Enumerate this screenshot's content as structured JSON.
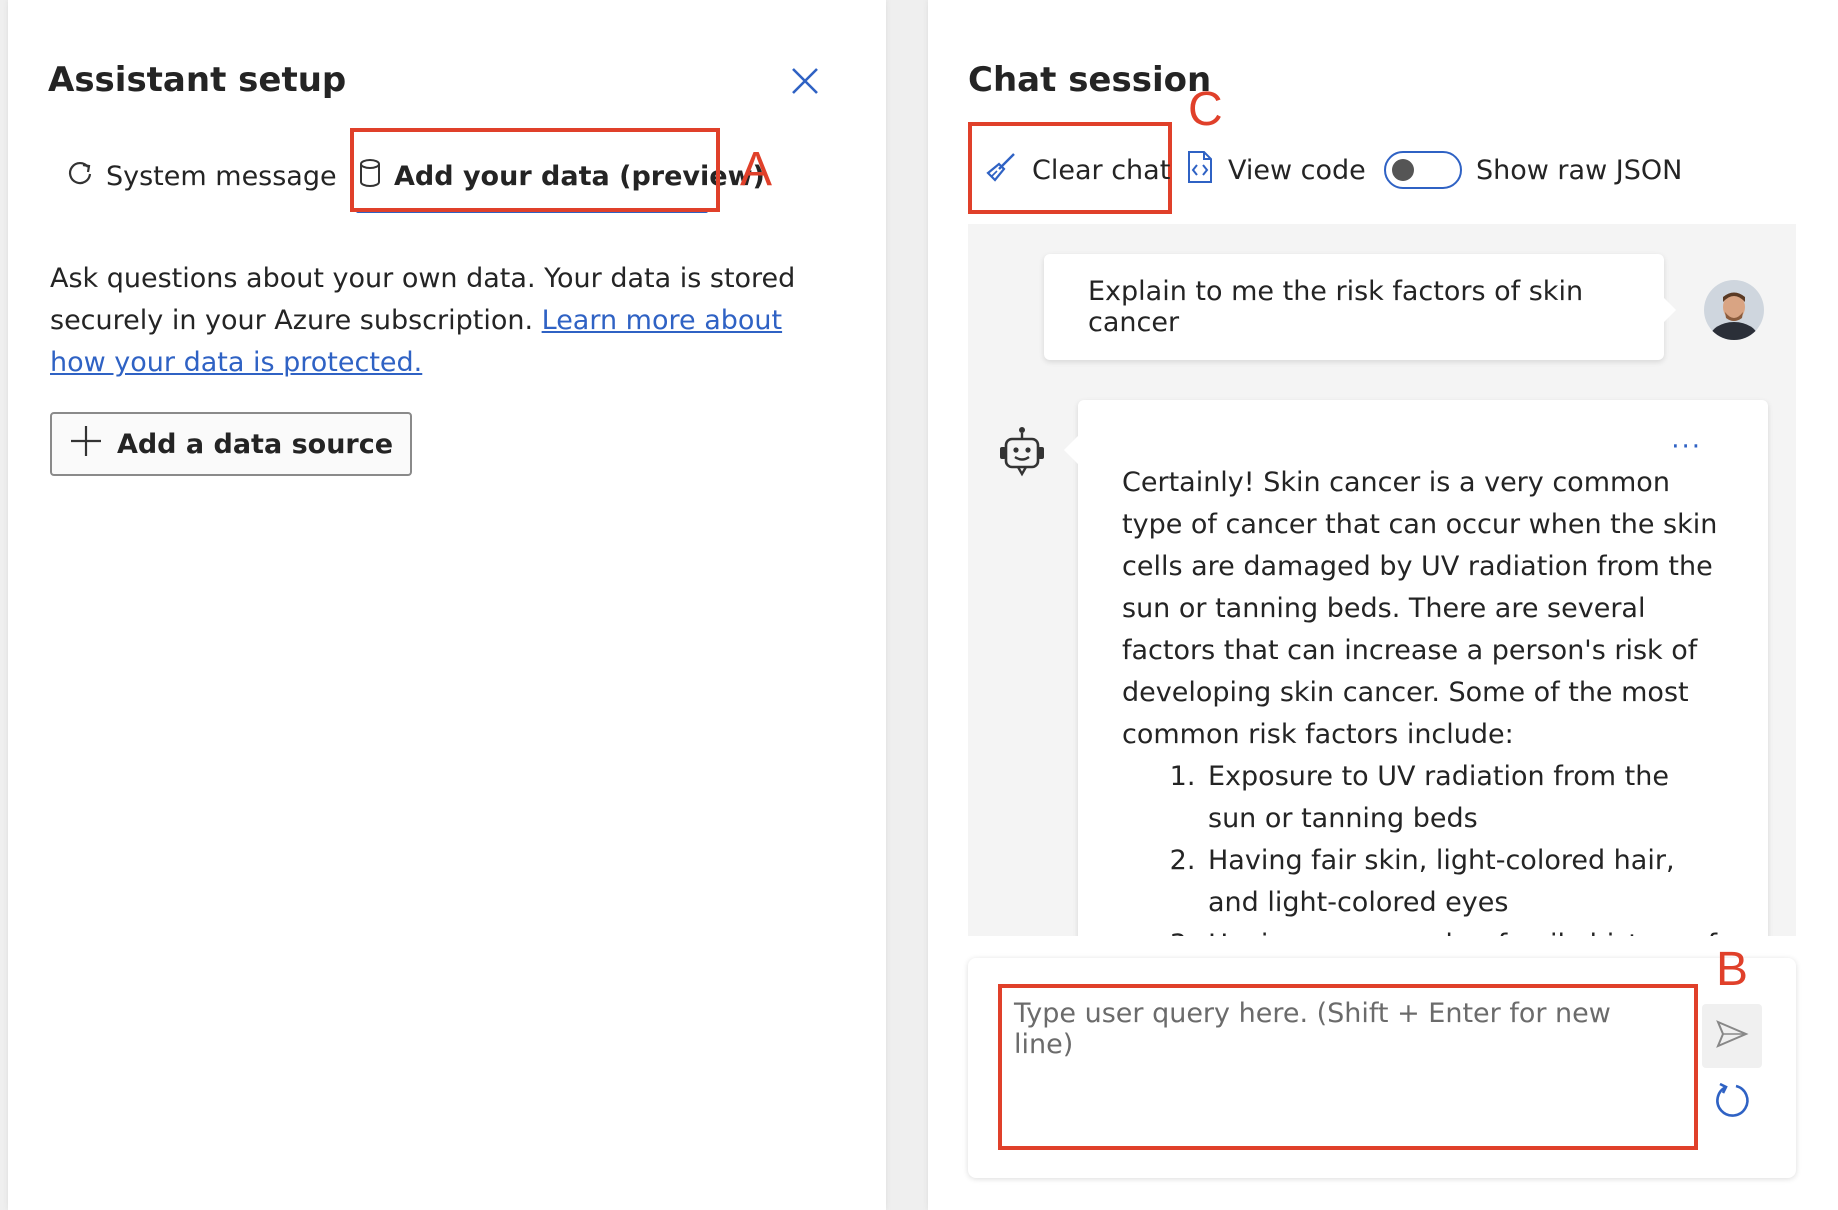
{
  "left_panel": {
    "title": "Assistant setup",
    "tabs": [
      {
        "label": "System message",
        "icon": "refresh-icon"
      },
      {
        "label": "Add your data (preview)",
        "icon": "database-icon",
        "selected": true
      }
    ],
    "description": "Ask questions about your own data. Your data is stored securely in your Azure subscription. ",
    "learn_more_link": "Learn more about how your data is protected.",
    "add_source_label": "Add a data source"
  },
  "right_panel": {
    "title": "Chat session",
    "toolbar": {
      "clear_chat": "Clear chat",
      "view_code": "View code",
      "show_raw_json": "Show raw JSON",
      "raw_json_enabled": false
    },
    "messages": {
      "user": "Explain to me the risk factors of skin cancer",
      "assistant_intro": "Certainly! Skin cancer is a very common type of cancer that can occur when the skin cells are damaged by UV radiation from the sun or tanning beds. There are several factors that can increase a person's risk of developing skin cancer. Some of the most common risk factors include:",
      "assistant_list": [
        "Exposure to UV radiation from the sun or tanning beds",
        "Having fair skin, light-colored hair, and light-colored eyes",
        "Having a personal or family history of skin cancer"
      ],
      "more_options": "···"
    },
    "input_placeholder": "Type user query here. (Shift + Enter for new line)"
  },
  "annotations": {
    "a": "A",
    "b": "B",
    "c": "C"
  },
  "colors": {
    "accent": "#2f62c4",
    "annotation": "#e0402a"
  }
}
